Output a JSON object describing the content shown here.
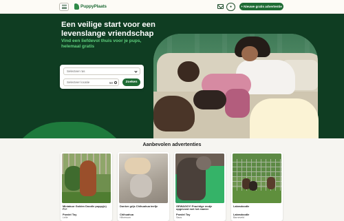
{
  "header": {
    "logo_text": "PuppyPlaats",
    "post_button_label": "+ Nieuwe gratis advertentie",
    "icons": [
      "menu-icon",
      "mail-icon",
      "user-icon"
    ]
  },
  "hero": {
    "title": "Een veilige start voor een levenslange vriendschap",
    "subtitle": "Vind een liefdevol thuis voor je pups, helemaal gratis",
    "search": {
      "select_placeholder": "Selecteer ras",
      "zip_placeholder": "Selecteer locatie",
      "distance_value": "50",
      "search_button_label": "Zoeken"
    }
  },
  "featured": {
    "title": "Aanbevolen advertenties",
    "cards": [
      {
        "title": "Miniatuur Golden Doodle puppy(s) F1+",
        "breed": "Poedel Toy",
        "location": "Lelie"
      },
      {
        "title": "Donker grijs Chihuahua teefje",
        "breed": "Chihuahua",
        "location": "Hilversum"
      },
      {
        "title": "GEWAGGY! Prachtige reutje opgevoed met het manier",
        "breed": "Poedel Toy",
        "location": "Saus"
      },
      {
        "title": "Labradoodle",
        "breed": "Labradoodle",
        "location": "Barneveld"
      }
    ]
  },
  "colors": {
    "hero_bg": "#0f3d22",
    "accent_green": "#1e6b34",
    "subtitle_green": "#5fd07d"
  }
}
